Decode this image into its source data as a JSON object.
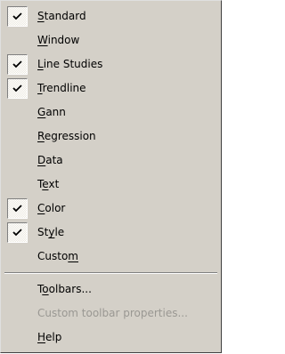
{
  "menu": {
    "items": [
      {
        "type": "item",
        "label": "Standard",
        "mnemonic_index": 0,
        "checked": true,
        "enabled": true
      },
      {
        "type": "item",
        "label": "Window",
        "mnemonic_index": 0,
        "checked": false,
        "enabled": true
      },
      {
        "type": "item",
        "label": "Line Studies",
        "mnemonic_index": 0,
        "checked": true,
        "enabled": true
      },
      {
        "type": "item",
        "label": "Trendline",
        "mnemonic_index": 0,
        "checked": true,
        "enabled": true
      },
      {
        "type": "item",
        "label": "Gann",
        "mnemonic_index": 0,
        "checked": false,
        "enabled": true
      },
      {
        "type": "item",
        "label": "Regression",
        "mnemonic_index": 0,
        "checked": false,
        "enabled": true
      },
      {
        "type": "item",
        "label": "Data",
        "mnemonic_index": 0,
        "checked": false,
        "enabled": true
      },
      {
        "type": "item",
        "label": "Text",
        "mnemonic_index": 1,
        "checked": false,
        "enabled": true
      },
      {
        "type": "item",
        "label": "Color",
        "mnemonic_index": 0,
        "checked": true,
        "enabled": true
      },
      {
        "type": "item",
        "label": "Style",
        "mnemonic_index": 2,
        "checked": true,
        "enabled": true
      },
      {
        "type": "item",
        "label": "Custom",
        "mnemonic_index": 5,
        "checked": false,
        "enabled": true
      },
      {
        "type": "separator"
      },
      {
        "type": "item",
        "label": "Toolbars...",
        "mnemonic_index": 1,
        "checked": false,
        "enabled": true
      },
      {
        "type": "item",
        "label": "Custom toolbar properties...",
        "mnemonic_index": -1,
        "checked": false,
        "enabled": false
      },
      {
        "type": "item",
        "label": "Help",
        "mnemonic_index": 0,
        "checked": false,
        "enabled": true
      }
    ]
  }
}
